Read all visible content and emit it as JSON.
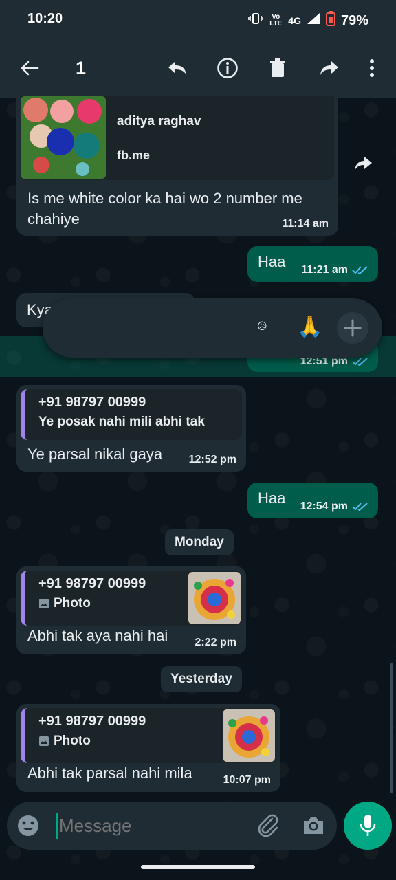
{
  "status_bar": {
    "time": "10:20",
    "network_label": "4G",
    "volte_label": "Vo LTE",
    "battery": "79%"
  },
  "header": {
    "selected_count": "1"
  },
  "messages": [
    {
      "id": "m1",
      "direction": "incoming",
      "link_preview": {
        "title": "aditya raghav",
        "domain": "fb.me"
      },
      "text": "Is me white color ka hai wo 2 number me chahiye",
      "time": "11:14 am"
    },
    {
      "id": "m2",
      "direction": "outgoing",
      "text": "Haa",
      "time": "11:21 am"
    },
    {
      "id": "m3",
      "direction": "incoming",
      "text": "Kya",
      "partially_hidden": true
    },
    {
      "id": "m4",
      "direction": "outgoing",
      "time": "12:51 pm",
      "selected": true
    },
    {
      "id": "m5",
      "direction": "incoming",
      "quote": {
        "name": "+91 98797 00999",
        "text": "Ye posak nahi mili abhi tak"
      },
      "text": "Ye parsal nikal gaya",
      "time": "12:52 pm"
    },
    {
      "id": "m6",
      "direction": "outgoing",
      "text": "Haa",
      "time": "12:54 pm"
    },
    {
      "id": "m7",
      "direction": "incoming",
      "quote": {
        "name": "+91 98797 00999",
        "text": "Photo"
      },
      "text": "Abhi tak aya nahi hai",
      "time": "2:22 pm"
    },
    {
      "id": "m8",
      "direction": "incoming",
      "quote": {
        "name": "+91 98797 00999",
        "text": "Photo"
      },
      "text": "Abhi tak parsal nahi mila",
      "time": "10:07 pm"
    }
  ],
  "date_chips": {
    "monday": "Monday",
    "yesterday": "Yesterday"
  },
  "reaction_bar": {
    "emojis": [
      "😥",
      "🙏"
    ]
  },
  "composer": {
    "placeholder": "Message"
  },
  "colors": {
    "background": "#0b141a",
    "bar": "#1f2c34",
    "incoming_bubble": "#1f2c34",
    "outgoing_bubble": "#005c4b",
    "accent": "#00a884",
    "read_tick": "#53bdeb",
    "quote_bar": "#a084e8"
  }
}
